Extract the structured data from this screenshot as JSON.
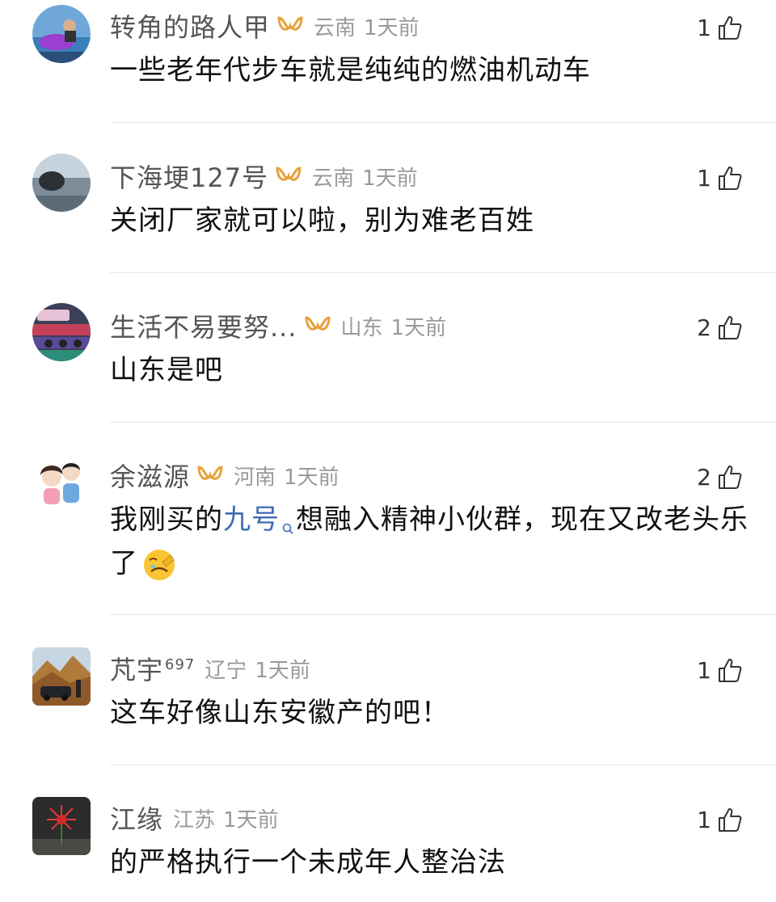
{
  "comments": [
    {
      "username": "转角的路人甲",
      "region": "云南",
      "time": "1天前",
      "likes": "1",
      "text": "一些老年代步车就是纯纯的燃油机动车",
      "vip": true
    },
    {
      "username": "下海埂127号",
      "region": "云南",
      "time": "1天前",
      "likes": "1",
      "text": "关闭厂家就可以啦，别为难老百姓",
      "vip": true
    },
    {
      "username": "生活不易要努...",
      "region": "山东",
      "time": "1天前",
      "likes": "2",
      "text": "山东是吧",
      "vip": true
    },
    {
      "username": "余滋源",
      "region": "河南",
      "time": "1天前",
      "likes": "2",
      "text_before": "我刚买的",
      "link_text": "九号",
      "text_after": "想融入精神小伙群，现在又改老头乐了",
      "emoji": "facepalm-emoji",
      "vip": true
    },
    {
      "username": "芃宇",
      "level": "697",
      "region": "辽宁",
      "time": "1天前",
      "likes": "1",
      "text": "这车好像山东安徽产的吧！",
      "vip": false
    },
    {
      "username": "江缘",
      "region": "江苏",
      "time": "1天前",
      "likes": "1",
      "text": "的严格执行一个未成年人整治法",
      "vip": false
    }
  ],
  "colors": {
    "vip_gold": "#e6a23c",
    "link_blue": "#3d6bb3",
    "meta_gray": "#9a9a9a",
    "name_gray": "#555555"
  },
  "icons": {
    "vip": "vip-badge-icon",
    "like": "thumbs-up-icon",
    "search": "search-icon"
  }
}
